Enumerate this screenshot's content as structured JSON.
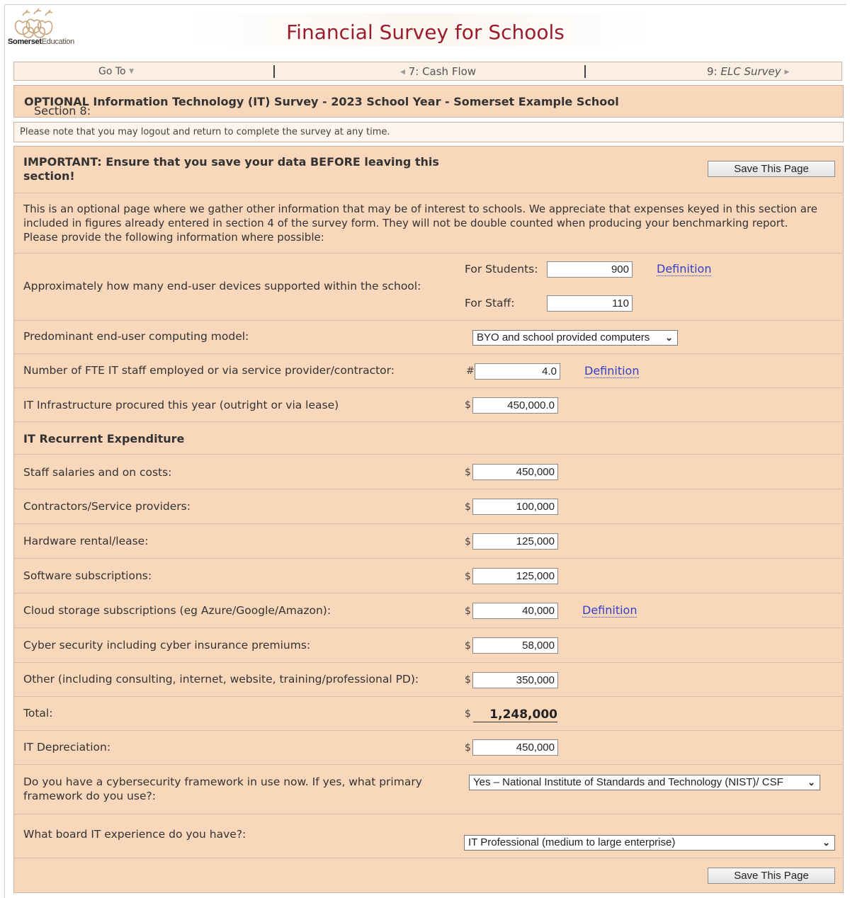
{
  "header": {
    "logo_brand_bold": "Somerset",
    "logo_brand_rest": "Education",
    "title": "Financial Survey for Schools"
  },
  "nav": {
    "goto_label": "Go To",
    "prev_label": "7: Cash Flow",
    "next_prefix": "9:",
    "next_label": "ELC Survey"
  },
  "section": {
    "prefix": "Section 8: ",
    "title": "OPTIONAL Information Technology (IT) Survey - 2023 School Year - Somerset Example School"
  },
  "note": "Please note that you may logout and return to complete the survey at any time.",
  "important": {
    "text": "IMPORTANT: Ensure that you save your data BEFORE leaving this section!",
    "save_label": "Save This Page"
  },
  "intro": "This is an optional page where we gather other information that may be of interest to schools. We appreciate that expenses keyed in this section are included in figures already entered in section 4 of the survey form. They will not be double counted when producing your benchmarking report. Please provide the following information where possible:",
  "devices": {
    "label": "Approximately how many end-user devices supported within the school:",
    "students_label": "For Students:",
    "students_value": "900",
    "staff_label": "For Staff:",
    "staff_value": "110",
    "definition": "Definition"
  },
  "computing_model": {
    "label": "Predominant end-user computing model:",
    "selected": "BYO and school provided computers"
  },
  "fte": {
    "label": "Number of FTE IT staff employed or via service provider/contractor:",
    "prefix": "#",
    "value": "4.0",
    "definition": "Definition"
  },
  "infrastructure": {
    "label": "IT Infrastructure procured this year (outright or via lease)",
    "prefix": "$",
    "value": "450,000.0"
  },
  "recurrent_heading": "IT Recurrent Expenditure",
  "expenses": [
    {
      "label": "Staff salaries and on costs:",
      "prefix": "$",
      "value": "450,000"
    },
    {
      "label": "Contractors/Service providers:",
      "prefix": "$",
      "value": "100,000"
    },
    {
      "label": "Hardware rental/lease:",
      "prefix": "$",
      "value": "125,000"
    },
    {
      "label": "Software subscriptions:",
      "prefix": "$",
      "value": "125,000"
    },
    {
      "label": "Cloud storage subscriptions (eg Azure/Google/Amazon):",
      "prefix": "$",
      "value": "40,000",
      "definition": "Definition"
    },
    {
      "label": "Cyber security including cyber insurance premiums:",
      "prefix": "$",
      "value": "58,000"
    },
    {
      "label": "Other (including consulting, internet, website, training/professional PD):",
      "prefix": "$",
      "value": "350,000"
    }
  ],
  "total": {
    "label": "Total:",
    "prefix": "$",
    "value": "1,248,000"
  },
  "depreciation": {
    "label": "IT Depreciation:",
    "prefix": "$",
    "value": "450,000"
  },
  "framework": {
    "label": "Do you have a cybersecurity framework in use now. If yes, what primary framework do you use?:",
    "selected": "Yes – National Institute of Standards and Technology (NIST)/ CSF"
  },
  "board": {
    "label": "What board IT experience do you have?:",
    "selected": "IT Professional (medium to large enterprise)"
  },
  "footer": {
    "save_label": "Save This Page"
  },
  "colors": {
    "title": "#9b1c2b",
    "panel": "#f9d7bb",
    "link": "#3340c8"
  }
}
